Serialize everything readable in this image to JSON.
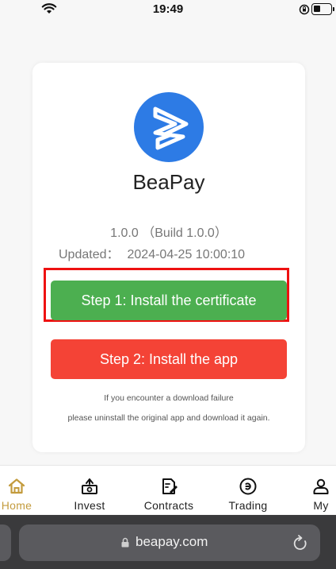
{
  "status_bar": {
    "time": "19:49"
  },
  "app": {
    "name": "BeaPay",
    "version": "1.0.0 （Build 1.0.0）",
    "updated_label": "Updated：",
    "updated_value": "2024-04-25 10:00:10"
  },
  "buttons": {
    "install_cert": "Step 1: Install the certificate",
    "install_app": "Step 2: Install the app"
  },
  "notes": {
    "line1": "If you encounter a download failure",
    "line2": "please uninstall the original app and download it again."
  },
  "bottom_nav": {
    "items": [
      {
        "label": "Home",
        "icon": "home-icon",
        "active": true
      },
      {
        "label": "Invest",
        "icon": "invest-icon",
        "active": false
      },
      {
        "label": "Contracts",
        "icon": "contracts-icon",
        "active": false
      },
      {
        "label": "Trading",
        "icon": "trading-icon",
        "active": false
      },
      {
        "label": "My",
        "icon": "user-icon",
        "active": false
      }
    ]
  },
  "browser": {
    "url": "beapay.com"
  },
  "colors": {
    "install_cert_button": "#4caf50",
    "install_app_button": "#f44336",
    "logo_blue": "#2d7be5",
    "active_nav": "#c39b3d",
    "highlight_box": "#ee1111"
  }
}
